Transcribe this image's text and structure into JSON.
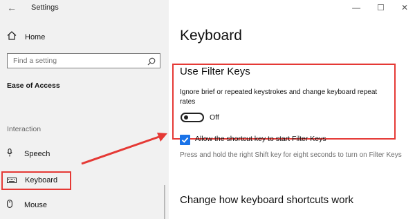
{
  "window": {
    "title": "Settings"
  },
  "sidebar": {
    "home_label": "Home",
    "search_placeholder": "Find a setting",
    "section_title": "Ease of Access",
    "group_label": "Interaction",
    "items": [
      {
        "label": "Speech",
        "icon": "microphone-icon"
      },
      {
        "label": "Keyboard",
        "icon": "keyboard-icon",
        "selected": true
      },
      {
        "label": "Mouse",
        "icon": "mouse-icon"
      }
    ]
  },
  "main": {
    "page_title": "Keyboard",
    "filter_keys": {
      "title": "Use Filter Keys",
      "description": "Ignore brief or repeated keystrokes and change keyboard repeat rates",
      "toggle_state": "Off",
      "checkbox_label": "Allow the shortcut key to start Filter Keys",
      "checkbox_checked": true,
      "checkbox_help": "Press and hold the right Shift key for eight seconds to turn on Filter Keys"
    },
    "next_section_title": "Change how keyboard shortcuts work"
  },
  "colors": {
    "annotation_red": "#e53935",
    "checkbox_blue": "#1a73e8",
    "sidebar_bg": "#f1f1f1"
  }
}
